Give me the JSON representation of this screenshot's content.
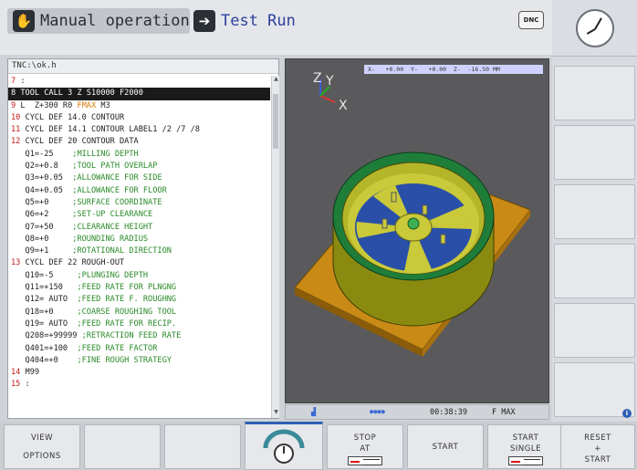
{
  "header": {
    "mode_tab": "Manual operation",
    "mode_tab_icon": "hand-icon",
    "active_tab": "Test Run",
    "active_tab_icon": "arrow-right-icon",
    "dnc_badge": "DNC"
  },
  "program": {
    "path": "TNC:\\ok.h",
    "lines": [
      {
        "ln": "7",
        "text": " :",
        "sel": false
      },
      {
        "ln": "8",
        "text": " TOOL CALL 3 Z S10000 F2000",
        "sel": true
      },
      {
        "ln": "9",
        "text": " L  Z+300 R0 FMAX M3",
        "sel": false
      },
      {
        "ln": "10",
        "text": " CYCL DEF 14.0 CONTOUR",
        "sel": false
      },
      {
        "ln": "11",
        "text": " CYCL DEF 14.1 CONTOUR LABEL1 /2 /7 /8",
        "sel": false
      },
      {
        "ln": "12",
        "text": " CYCL DEF 20 CONTOUR DATA",
        "sel": false
      },
      {
        "ln": "",
        "text": "   Q1=-25    ;MILLING DEPTH",
        "sel": false
      },
      {
        "ln": "",
        "text": "   Q2=+0.8   ;TOOL PATH OVERLAP",
        "sel": false
      },
      {
        "ln": "",
        "text": "   Q3=+0.05  ;ALLOWANCE FOR SIDE",
        "sel": false
      },
      {
        "ln": "",
        "text": "   Q4=+0.05  ;ALLOWANCE FOR FLOOR",
        "sel": false
      },
      {
        "ln": "",
        "text": "   Q5=+0     ;SURFACE COORDINATE",
        "sel": false
      },
      {
        "ln": "",
        "text": "   Q6=+2     ;SET-UP CLEARANCE",
        "sel": false
      },
      {
        "ln": "",
        "text": "   Q7=+50    ;CLEARANCE HEIGHT",
        "sel": false
      },
      {
        "ln": "",
        "text": "   Q8=+0     ;ROUNDING RADIUS",
        "sel": false
      },
      {
        "ln": "",
        "text": "   Q9=+1     ;ROTATIONAL DIRECTION",
        "sel": false
      },
      {
        "ln": "13",
        "text": " CYCL DEF 22 ROUGH-OUT",
        "sel": false
      },
      {
        "ln": "",
        "text": "   Q10=-5     ;PLUNGING DEPTH",
        "sel": false
      },
      {
        "ln": "",
        "text": "   Q11=+150   ;FEED RATE FOR PLNGNG",
        "sel": false
      },
      {
        "ln": "",
        "text": "   Q12= AUTO  ;FEED RATE F. ROUGHNG",
        "sel": false
      },
      {
        "ln": "",
        "text": "   Q18=+0     ;COARSE ROUGHING TOOL",
        "sel": false
      },
      {
        "ln": "",
        "text": "   Q19= AUTO  ;FEED RATE FOR RECIP.",
        "sel": false
      },
      {
        "ln": "",
        "text": "   Q208=+99999 ;RETRACTION FEED RATE",
        "sel": false
      },
      {
        "ln": "",
        "text": "   Q401=+100  ;FEED RATE FACTOR",
        "sel": false
      },
      {
        "ln": "",
        "text": "   Q404=+0    ;FINE ROUGH STRATEGY",
        "sel": false
      },
      {
        "ln": "14",
        "text": " M99",
        "sel": false
      },
      {
        "ln": "15",
        "text": " :",
        "sel": false
      }
    ]
  },
  "graphics": {
    "axis_labels": {
      "z": "Z",
      "y": "Y",
      "x": "X"
    },
    "coord_readout": "X-   +0.00  Y-   +0.00  Z-  -16.50 MM"
  },
  "status": {
    "run_time": "00:38:39",
    "feed": "F MAX"
  },
  "softkeys": {
    "view_options_line1": "VIEW",
    "view_options_line2": "OPTIONS",
    "stop_at_line1": "STOP",
    "stop_at_line2": "AT",
    "start": "START",
    "start_single_line1": "START",
    "start_single_line2": "SINGLE",
    "reset_line1": "RESET",
    "reset_line2": "+",
    "reset_line3": "START"
  }
}
